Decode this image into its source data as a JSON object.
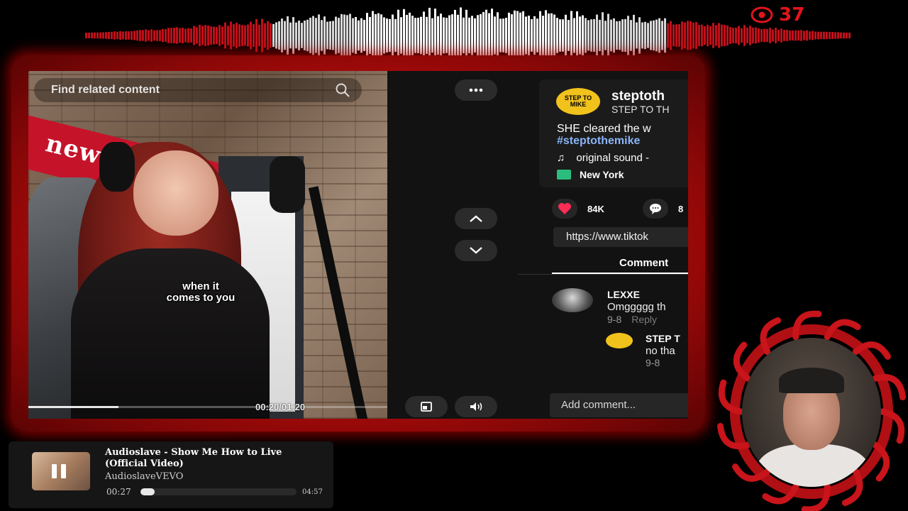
{
  "overlay": {
    "viewer_count": "37",
    "viewer_icon": "eye-icon"
  },
  "video": {
    "search_placeholder": "Find related content",
    "awning_text": "new",
    "caption_line1": "when it",
    "caption_line2": "comes to you",
    "current_time": "00:20",
    "duration": "01:20",
    "time_display": "00:20/01:20",
    "progress_fraction": 0.25
  },
  "controls": {
    "more_icon": "more-dots-icon",
    "prev_icon": "chevron-up-icon",
    "next_icon": "chevron-down-icon",
    "pip_icon": "picture-in-picture-icon",
    "volume_icon": "volume-icon"
  },
  "post": {
    "logo_text": "STEP TO MIKE",
    "author": "steptoth",
    "author_sub": "STEP TO TH",
    "description": "SHE cleared the w",
    "hashtag": "#steptothemike",
    "sound_icon": "♫",
    "sound": "original sound -",
    "location": "New York",
    "likes": "84K",
    "comments_count": "8",
    "link": "https://www.tiktok",
    "tab_comments": "Comment",
    "add_comment_placeholder": "Add comment..."
  },
  "comments": [
    {
      "name": "LEXXE",
      "text": "Omggggg th",
      "date": "9-8",
      "reply": "Reply"
    },
    {
      "name": "STEP T",
      "text": "no tha",
      "date": "9-8",
      "reply": ""
    }
  ],
  "player": {
    "title": "Audioslave - Show Me How to Live (Official Video)",
    "artist": "AudioslaveVEVO",
    "current_time": "00:27",
    "duration": "04:57",
    "progress_fraction": 0.09
  },
  "colors": {
    "accent_red": "#e3141a",
    "frame_red": "#c40d0d",
    "like_red": "#fe2c55",
    "hashtag": "#8ab4f8"
  }
}
